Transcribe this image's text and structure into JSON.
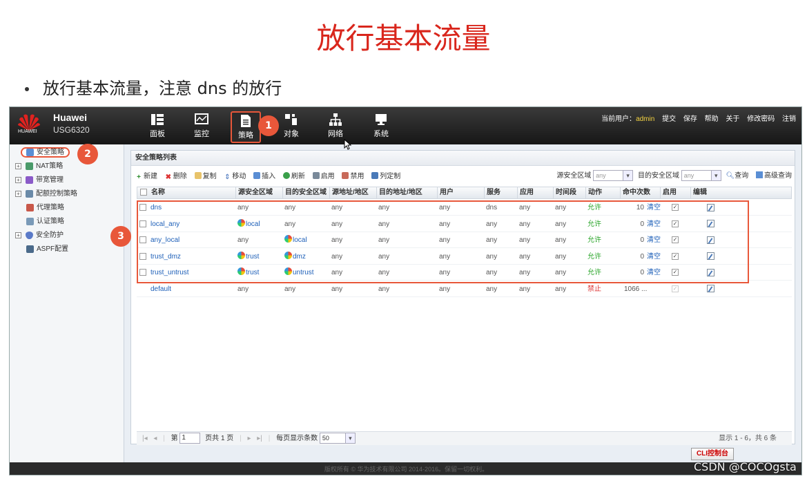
{
  "slide": {
    "title": "放行基本流量",
    "bullet": "放行基本流量，注意 dns 的放行"
  },
  "app": {
    "brand_name": "Huawei",
    "model": "USG6320",
    "logo_text": "HUAWEI",
    "nav": [
      {
        "label": "面板",
        "icon": "dashboard-icon"
      },
      {
        "label": "监控",
        "icon": "monitor-icon"
      },
      {
        "label": "策略",
        "icon": "document-icon",
        "active": true
      },
      {
        "label": "对象",
        "icon": "object-icon"
      },
      {
        "label": "网络",
        "icon": "network-icon"
      },
      {
        "label": "系统",
        "icon": "system-icon"
      }
    ],
    "user_bar": {
      "user_label": "当前用户：",
      "username": "admin",
      "links": [
        "提交",
        "保存",
        "帮助",
        "关于",
        "修改密码",
        "注销"
      ]
    },
    "sidebar": [
      {
        "label": "安全策略",
        "expandable": false,
        "active": true
      },
      {
        "label": "NAT策略",
        "expandable": true
      },
      {
        "label": "带宽管理",
        "expandable": true
      },
      {
        "label": "配额控制策略",
        "expandable": true
      },
      {
        "label": "代理策略",
        "expandable": false
      },
      {
        "label": "认证策略",
        "expandable": false
      },
      {
        "label": "安全防护",
        "expandable": true
      },
      {
        "label": "ASPF配置",
        "expandable": false
      }
    ],
    "panel_title": "安全策略列表",
    "toolbar": [
      "新建",
      "删除",
      "复制",
      "移动",
      "插入",
      "刷新",
      "启用",
      "禁用",
      "列定制"
    ],
    "filters": {
      "src_label": "源安全区域",
      "src_value": "any",
      "dst_label": "目的安全区域",
      "dst_value": "any",
      "search": "查询",
      "advanced": "高级查询"
    },
    "columns": [
      "名称",
      "源安全区域",
      "目的安全区域",
      "源地址/地区",
      "目的地址/地区",
      "用户",
      "服务",
      "应用",
      "时间段",
      "动作",
      "命中次数",
      "启用",
      "编辑"
    ],
    "rows": [
      {
        "name": "dns",
        "src_zone": "any",
        "src_zone_icon": false,
        "dst_zone": "any",
        "dst_zone_icon": false,
        "src_addr": "any",
        "dst_addr": "any",
        "user": "any",
        "service": "dns",
        "app": "any",
        "time": "any",
        "action": "允许",
        "hits": "10",
        "clear": "清空",
        "enabled": true
      },
      {
        "name": "local_any",
        "src_zone": "local",
        "src_zone_icon": true,
        "dst_zone": "any",
        "dst_zone_icon": false,
        "src_addr": "any",
        "dst_addr": "any",
        "user": "any",
        "service": "any",
        "app": "any",
        "time": "any",
        "action": "允许",
        "hits": "0",
        "clear": "清空",
        "enabled": true
      },
      {
        "name": "any_local",
        "src_zone": "any",
        "src_zone_icon": false,
        "dst_zone": "local",
        "dst_zone_icon": true,
        "src_addr": "any",
        "dst_addr": "any",
        "user": "any",
        "service": "any",
        "app": "any",
        "time": "any",
        "action": "允许",
        "hits": "0",
        "clear": "清空",
        "enabled": true
      },
      {
        "name": "trust_dmz",
        "src_zone": "trust",
        "src_zone_icon": true,
        "dst_zone": "dmz",
        "dst_zone_icon": true,
        "src_addr": "any",
        "dst_addr": "any",
        "user": "any",
        "service": "any",
        "app": "any",
        "time": "any",
        "action": "允许",
        "hits": "0",
        "clear": "清空",
        "enabled": true
      },
      {
        "name": "trust_untrust",
        "src_zone": "trust",
        "src_zone_icon": true,
        "dst_zone": "untrust",
        "dst_zone_icon": true,
        "src_addr": "any",
        "dst_addr": "any",
        "user": "any",
        "service": "any",
        "app": "any",
        "time": "any",
        "action": "允许",
        "hits": "0",
        "clear": "清空",
        "enabled": true
      },
      {
        "name": "default",
        "src_zone": "any",
        "src_zone_icon": false,
        "dst_zone": "any",
        "dst_zone_icon": false,
        "src_addr": "any",
        "dst_addr": "any",
        "user": "any",
        "service": "any",
        "app": "any",
        "time": "any",
        "action": "禁止",
        "hits": "1066 ...",
        "clear": "",
        "enabled": true
      }
    ],
    "pager": {
      "page_prefix": "第",
      "page_value": "1",
      "page_suffix": "页共 1 页",
      "per_page_label": "每页显示条数",
      "per_page_value": "50",
      "summary": "显示 1 - 6，共 6 条"
    },
    "footer": "版权所有 © 华为技术有限公司 2014-2016。保留一切权利。",
    "cli_button": "CLI控制台"
  },
  "annotations": {
    "badge_1": "1",
    "badge_2": "2",
    "badge_3": "3"
  },
  "watermark": "CSDN @COCOgsta",
  "colors": {
    "title_red": "#d9261c",
    "highlight_orange": "#e8573a",
    "allow_green": "#2aa52a",
    "deny_red": "#dd3333",
    "link_blue": "#1d5fb8"
  }
}
